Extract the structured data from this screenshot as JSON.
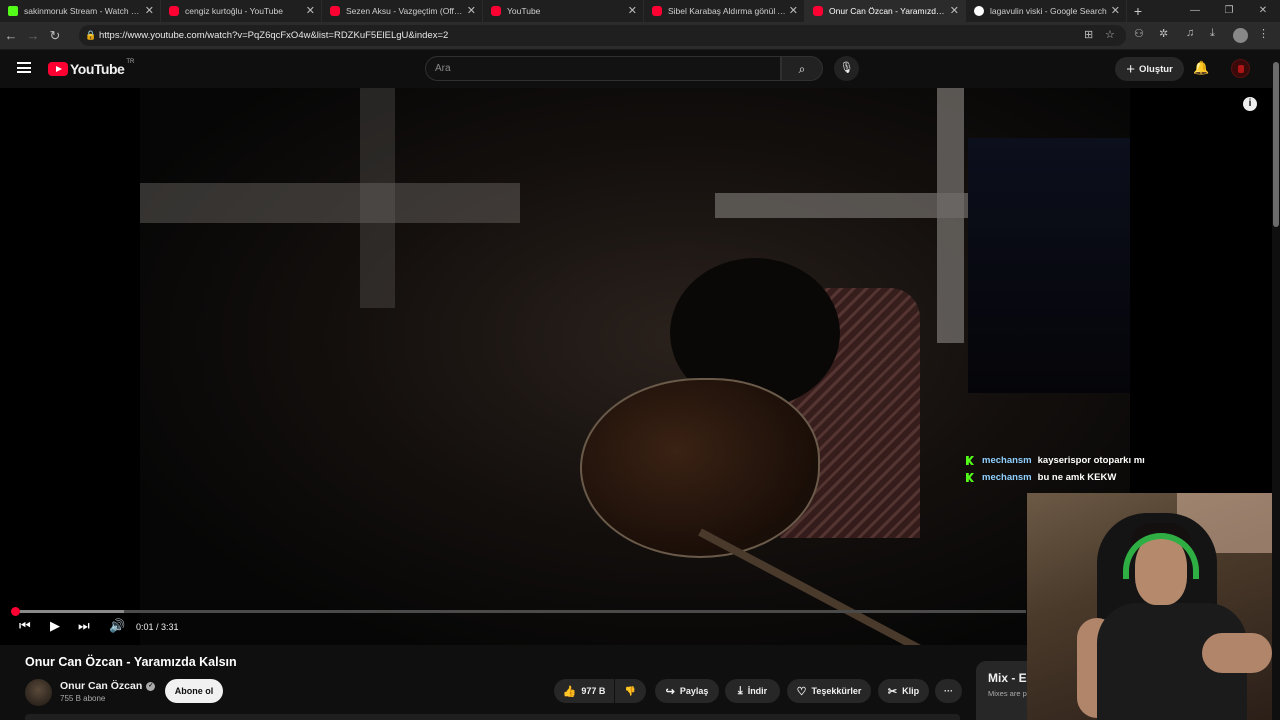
{
  "browser": {
    "tabs": [
      {
        "title": "sakinmoruk Stream - Watch Live o",
        "favicon": "kick-icon"
      },
      {
        "title": "cengiz kurtoğlu - YouTube",
        "favicon": "youtube-icon"
      },
      {
        "title": "Sezen Aksu - Vazgeçtim (Official a",
        "favicon": "youtube-icon"
      },
      {
        "title": "YouTube",
        "favicon": "youtube-icon"
      },
      {
        "title": "Sibel Karabaş Aldırma gönül Aldır",
        "favicon": "youtube-icon"
      },
      {
        "title": "Onur Can Özcan - Yaramızda Kals",
        "favicon": "youtube-icon",
        "active": true
      },
      {
        "title": "lagavulin viski - Google Search",
        "favicon": "google-icon"
      }
    ],
    "url": "https://www.youtube.com/watch?v=PqZ6qcFxO4w&list=RDZKuF5ElELgU&index=2"
  },
  "youtube": {
    "logo_text": "YouTube",
    "country_code": "TR",
    "search_placeholder": "Ara",
    "create_label": "Oluştur"
  },
  "player": {
    "time": "0:01 / 3:31",
    "progress_fraction": 0.003,
    "buffered_fraction": 0.11
  },
  "overlay_chat": [
    {
      "user": "mechansm",
      "message": "kayserispor otoparkı mı"
    },
    {
      "user": "mechansm",
      "message": "bu ne amk KEKW"
    }
  ],
  "video": {
    "title": "Onur Can Özcan - Yaramızda Kalsın",
    "channel": "Onur Can Özcan",
    "subscribers": "755 B abone",
    "subscribe_label": "Abone ol",
    "likes": "977 B",
    "share_label": "Paylaş",
    "download_label": "İndir",
    "thanks_label": "Teşekkürler",
    "clip_label": "Klip",
    "more_label": "···"
  },
  "mix": {
    "title": "Mix - E",
    "subtitle": "Mixes are p"
  },
  "colors": {
    "accent": "#ff0033",
    "kick": "#53fc18",
    "chat_user": "#8fd0ff"
  }
}
